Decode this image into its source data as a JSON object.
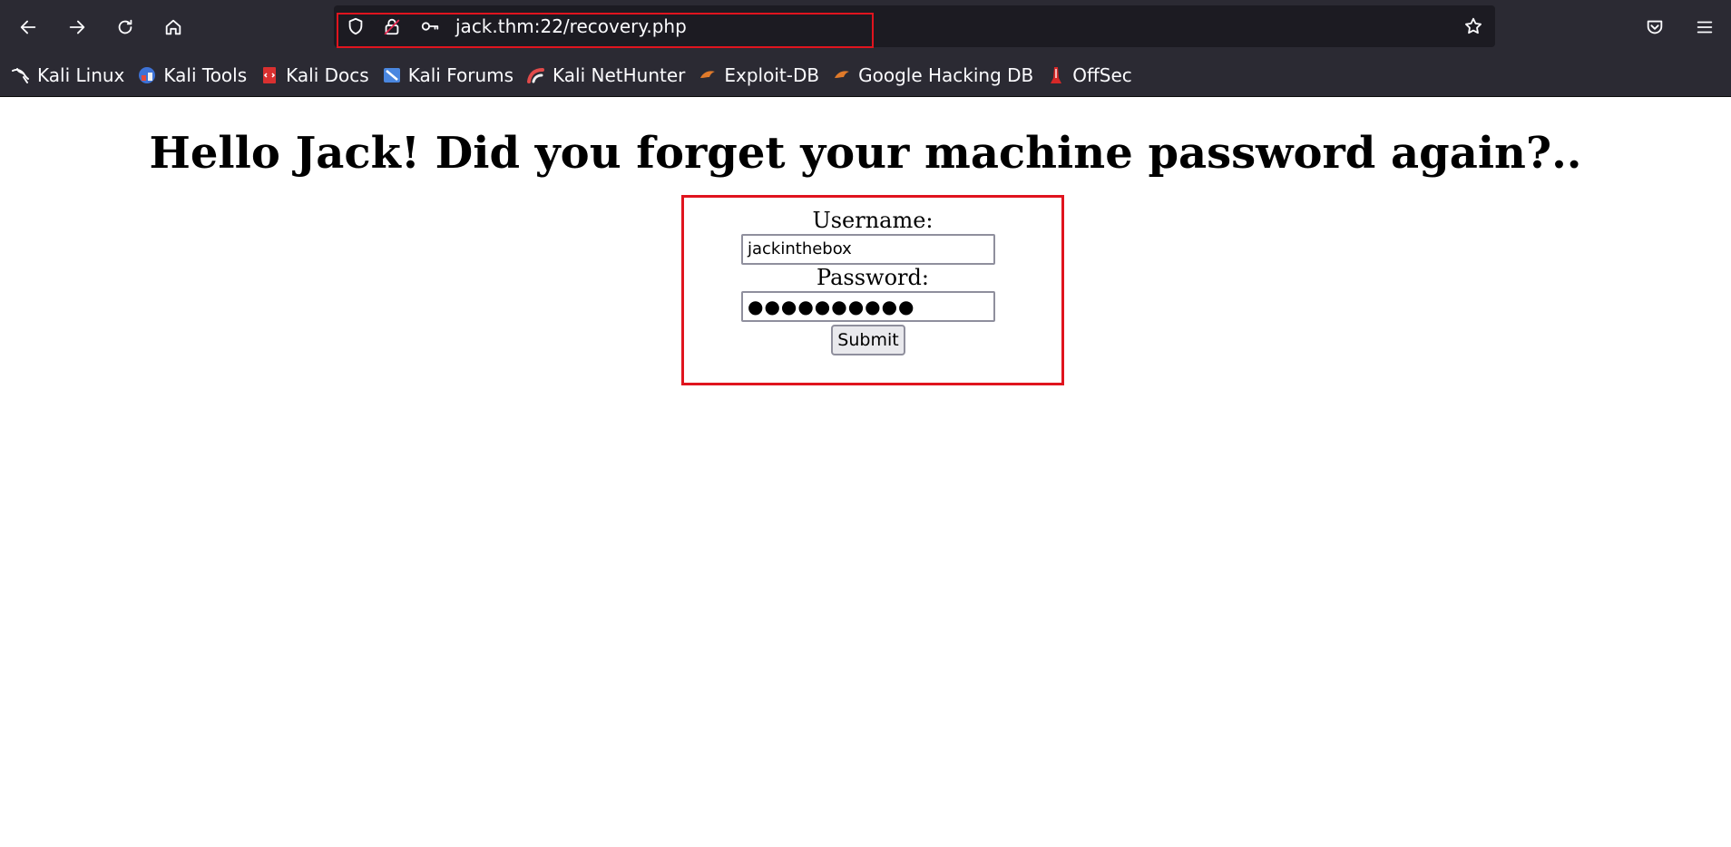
{
  "browser": {
    "url": "jack.thm:22/recovery.php",
    "bookmarks": [
      {
        "label": "Kali Linux",
        "icon": "kali-dragon-icon"
      },
      {
        "label": "Kali Tools",
        "icon": "kali-tools-icon"
      },
      {
        "label": "Kali Docs",
        "icon": "kali-docs-icon"
      },
      {
        "label": "Kali Forums",
        "icon": "kali-forums-icon"
      },
      {
        "label": "Kali NetHunter",
        "icon": "kali-nethunter-icon"
      },
      {
        "label": "Exploit-DB",
        "icon": "exploit-db-icon"
      },
      {
        "label": "Google Hacking DB",
        "icon": "google-hacking-db-icon"
      },
      {
        "label": "OffSec",
        "icon": "offsec-icon"
      }
    ]
  },
  "page": {
    "heading": "Hello Jack! Did you forget your machine password again?..",
    "form": {
      "username_label": "Username:",
      "username_value": "jackinthebox",
      "password_label": "Password:",
      "password_masked": "●●●●●●●●●●",
      "submit_label": "Submit"
    }
  },
  "colors": {
    "chrome_bg": "#2b2a33",
    "urlbar_bg": "#1c1b22",
    "highlight": "#e0141e"
  }
}
